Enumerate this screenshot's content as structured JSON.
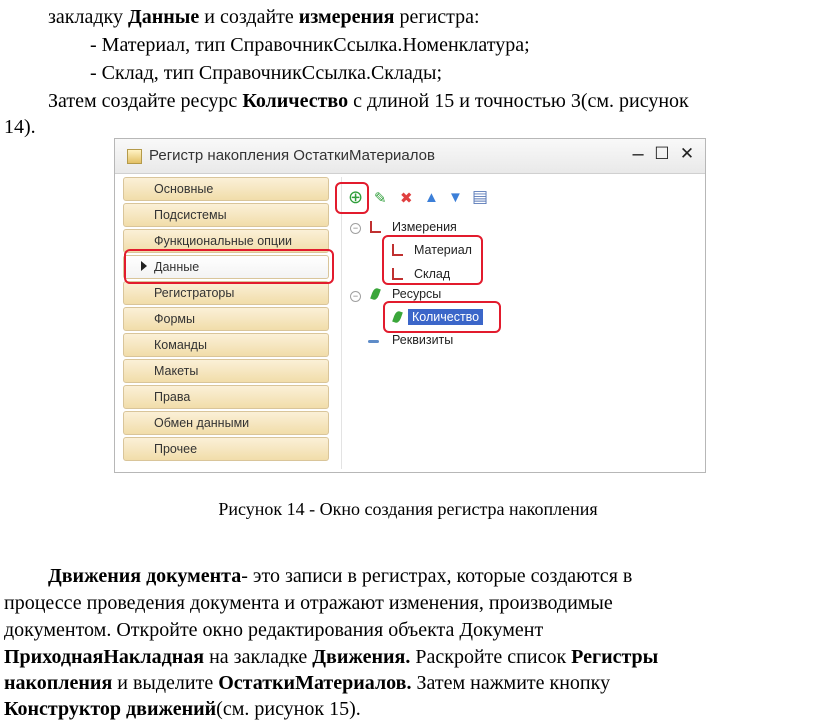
{
  "text": {
    "line1_a": "закладку ",
    "line1_b": "Данные",
    "line1_c": " и создайте ",
    "line1_d": "измерения",
    "line1_e": " регистра:",
    "bullet1": "-   Материал, тип СправочникСсылка.Номенклатура;",
    "bullet2": "-   Склад, тип СправочникСсылка.Склады;",
    "line4_a": "Затем создайте ресурс ",
    "line4_b": "Количество",
    "line4_c": " с длиной 15 и точностью 3(см. рисунок",
    "line5": "14).",
    "caption": "Рисунок 14 - Окно создания регистра накопления",
    "p1_a": "Движения документа",
    "p1_b": "- это записи в регистрах, которые создаются в",
    "p2": "процессе проведения документа и отражают изменения, производимые",
    "p3": "документом. Откройте окно редактирования объекта Документ",
    "p4_a": "ПриходнаяНакладная",
    "p4_b": " на закладке ",
    "p4_c": "Движения.",
    "p4_d": " Раскройте список ",
    "p4_e": "Регистры",
    "p5_a": "накопления",
    "p5_b": " и выделите ",
    "p5_c": "ОстаткиМатериалов.",
    "p5_d": " Затем нажмите кнопку",
    "p6_a": "Конструктор движений",
    "p6_b": "(см. рисунок 15)."
  },
  "window": {
    "title": "Регистр накопления ОстаткиМатериалов",
    "min": "–",
    "max": "☐",
    "close": "✕",
    "nav": [
      "Основные",
      "Подсистемы",
      "Функциональные опции",
      "Данные",
      "Регистраторы",
      "Формы",
      "Команды",
      "Макеты",
      "Права",
      "Обмен данными",
      "Прочее"
    ],
    "toolbar": {
      "add": "⊕",
      "edit": "✎",
      "delete": "✖",
      "up": "▲",
      "down": "▼",
      "list": "▤"
    },
    "tree": {
      "dims": "Измерения",
      "dim1": "Материал",
      "dim2": "Склад",
      "res": "Ресурсы",
      "res1": "Количество",
      "attrs": "Реквизиты"
    }
  }
}
